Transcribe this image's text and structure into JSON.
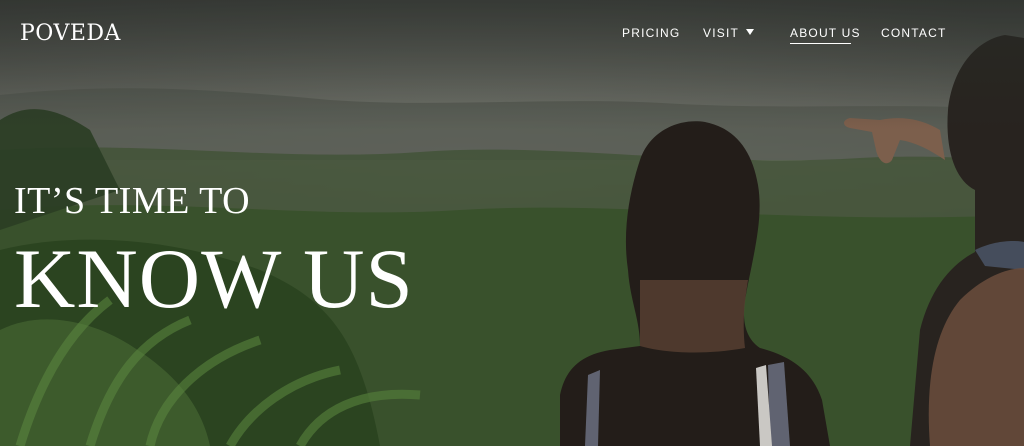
{
  "header": {
    "logo": "POVEDA",
    "nav": {
      "pricing": "PRICING",
      "visit": "VISIT",
      "about": "ABOUT US",
      "contact": "CONTACT"
    },
    "active_item": "ABOUT US"
  },
  "hero": {
    "line1": "IT’S TIME TO",
    "line2": "KNOW US"
  },
  "colors": {
    "text": "#ffffff",
    "sky": "#6f7069",
    "foliage": "#3f5a2f",
    "dark_foliage": "#263524"
  },
  "icons": {
    "visit_dropdown": "chevron-down-icon"
  }
}
